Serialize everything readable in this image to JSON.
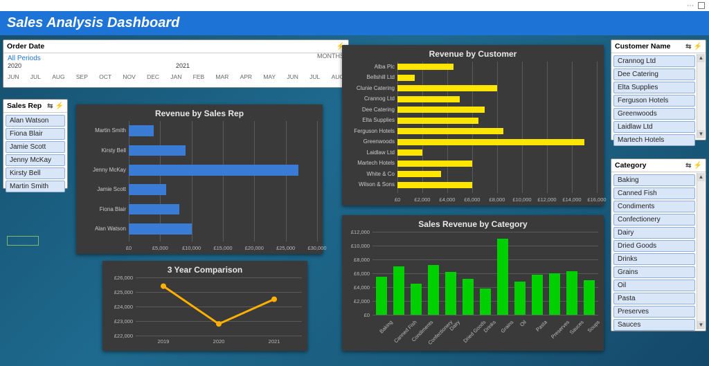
{
  "window": {
    "title": "Sales Analysis Dashboard"
  },
  "timeline": {
    "title": "Order Date",
    "range_label": "All Periods",
    "unit_label": "MONTHS",
    "years": [
      "2020",
      "2021"
    ],
    "months": [
      "JUN",
      "JUL",
      "AUG",
      "SEP",
      "OCT",
      "NOV",
      "DEC",
      "JAN",
      "FEB",
      "MAR",
      "APR",
      "MAY",
      "JUN",
      "JUL",
      "AUG"
    ]
  },
  "slicers": {
    "sales_rep": {
      "title": "Sales Rep",
      "items": [
        "Alan Watson",
        "Fiona Blair",
        "Jamie Scott",
        "Jenny McKay",
        "Kirsty Bell",
        "Martin Smith"
      ]
    },
    "customer": {
      "title": "Customer Name",
      "items": [
        "Crannog Ltd",
        "Dee Catering",
        "Elta Supplies",
        "Ferguson Hotels",
        "Greenwoods",
        "Laidlaw Ltd",
        "Martech Hotels"
      ]
    },
    "category": {
      "title": "Category",
      "items": [
        "Baking",
        "Canned Fish",
        "Condiments",
        "Confectionery",
        "Dairy",
        "Dried Goods",
        "Drinks",
        "Grains",
        "Oil",
        "Pasta",
        "Preserves",
        "Sauces"
      ]
    }
  },
  "chart_data": [
    {
      "id": "rev_by_rep",
      "type": "bar",
      "orientation": "horizontal",
      "title": "Revenue by Sales Rep",
      "categories": [
        "Martin Smith",
        "Kirsty Bell",
        "Jenny McKay",
        "Jamie Scott",
        "Fiona Blair",
        "Alan Watson"
      ],
      "values": [
        4000,
        9000,
        27000,
        6000,
        8000,
        10000
      ],
      "xlabel": "",
      "ylabel": "",
      "xlim": [
        0,
        30000
      ],
      "x_ticks": [
        "£0",
        "£5,000",
        "£10,000",
        "£15,000",
        "£20,000",
        "£25,000",
        "£30,000"
      ],
      "color": "#3a7bd5"
    },
    {
      "id": "rev_by_customer",
      "type": "bar",
      "orientation": "horizontal",
      "title": "Revenue by Customer",
      "categories": [
        "Alba Plc",
        "Bellshill Ltd",
        "Clunie Catering",
        "Crannog Ltd",
        "Dee Catering",
        "Elta Supplies",
        "Ferguson Hotels",
        "Greenwoods",
        "Laidlaw Ltd",
        "Martech Hotels",
        "White & Co",
        "Wilson & Sons"
      ],
      "values": [
        4500,
        1400,
        8000,
        5000,
        7000,
        6500,
        8500,
        15000,
        2000,
        6000,
        3500,
        6000
      ],
      "xlim": [
        0,
        16000
      ],
      "x_ticks": [
        "£0",
        "£2,000",
        "£4,000",
        "£6,000",
        "£8,000",
        "£10,000",
        "£12,000",
        "£14,000",
        "£16,000"
      ],
      "color": "#ffe600"
    },
    {
      "id": "three_year",
      "type": "line",
      "title": "3 Year Comparison",
      "categories": [
        "2019",
        "2020",
        "2021"
      ],
      "values": [
        25400,
        22800,
        24500
      ],
      "ylim": [
        22000,
        26000
      ],
      "y_ticks": [
        "£22,000",
        "£23,000",
        "£24,000",
        "£25,000",
        "£26,000"
      ],
      "color": "#ffb000"
    },
    {
      "id": "rev_by_category",
      "type": "bar",
      "orientation": "vertical",
      "title": "Sales Revenue by Category",
      "categories": [
        "Baking",
        "Canned Fish",
        "Condiments",
        "Confectionery",
        "Dairy",
        "Dried Goods",
        "Drinks",
        "Grains",
        "Oil",
        "Pasta",
        "Preserves",
        "Sauces",
        "Soups"
      ],
      "values": [
        5500,
        7000,
        4500,
        7200,
        6200,
        5200,
        3800,
        11000,
        4800,
        5800,
        6000,
        6300,
        5000
      ],
      "ylim": [
        0,
        12000
      ],
      "y_ticks": [
        "£0",
        "£2,000",
        "£4,000",
        "£6,000",
        "£8,000",
        "£10,000",
        "£12,000"
      ],
      "color": "#00d000"
    }
  ]
}
